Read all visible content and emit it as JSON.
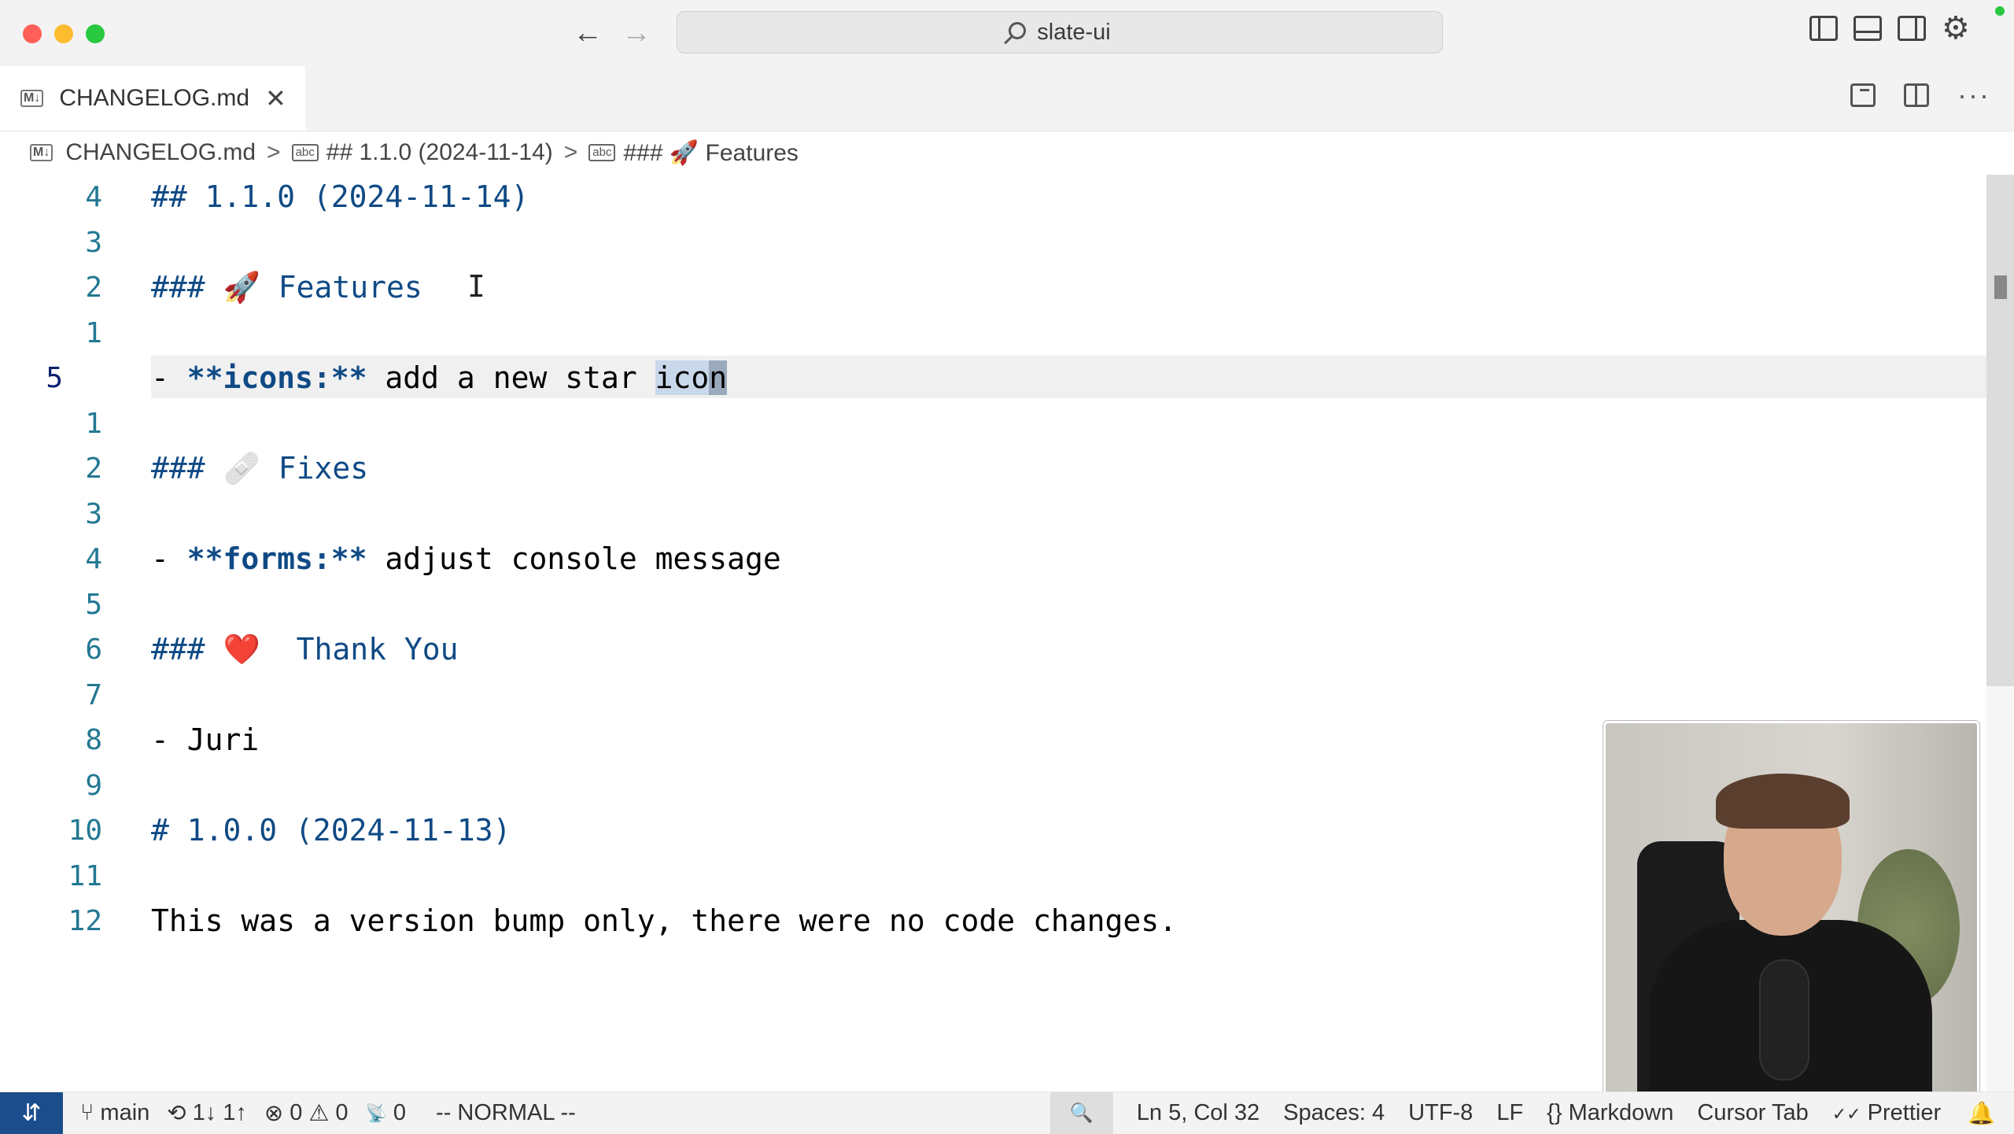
{
  "window": {
    "title": "slate-ui"
  },
  "tabs": [
    {
      "label": "CHANGELOG.md",
      "badge": "M↓"
    }
  ],
  "breadcrumb": [
    {
      "label": "CHANGELOG.md",
      "icon": "M↓"
    },
    {
      "label": "## 1.1.0 (2024-11-14)",
      "icon": "abc"
    },
    {
      "label": "### 🚀 Features",
      "icon": "abc"
    }
  ],
  "editor": {
    "lines": [
      {
        "number": "4",
        "text": "## 1.1.0 (2024-11-14)"
      },
      {
        "number": "3",
        "text": ""
      },
      {
        "number": "2",
        "text": "### 🚀 Features"
      },
      {
        "number": "1",
        "text": ""
      },
      {
        "number": "5",
        "text": "- **icons:** add a new star icon",
        "current": true
      },
      {
        "number": "1",
        "text": ""
      },
      {
        "number": "2",
        "text": "### 🩹 Fixes"
      },
      {
        "number": "3",
        "text": ""
      },
      {
        "number": "4",
        "text": "- **forms:** adjust console message"
      },
      {
        "number": "5",
        "text": ""
      },
      {
        "number": "6",
        "text": "### ❤️  Thank You"
      },
      {
        "number": "7",
        "text": ""
      },
      {
        "number": "8",
        "text": "- Juri"
      },
      {
        "number": "9",
        "text": ""
      },
      {
        "number": "10",
        "text": "# 1.0.0 (2024-11-13)"
      },
      {
        "number": "11",
        "text": ""
      },
      {
        "number": "12",
        "text": "This was a version bump only, there were no code changes."
      }
    ]
  },
  "statusbar": {
    "remote_icon": "⇵",
    "branch": "main",
    "sync": "1↓ 1↑",
    "errors": "0",
    "warnings": "0",
    "ports": "0",
    "mode": "-- NORMAL --",
    "position": "Ln 5, Col 32",
    "spaces": "Spaces: 4",
    "encoding": "UTF-8",
    "eol": "LF",
    "language": "Markdown",
    "cursor_tab": "Cursor Tab",
    "prettier": "Prettier"
  },
  "icons": {
    "nav_back": "←",
    "nav_fwd": "→",
    "close": "✕",
    "gear": "⚙",
    "more": "···",
    "chevron": ">",
    "ibeam": "I",
    "branch": "⑂",
    "sync": "⟲",
    "error": "⊗",
    "warning": "⚠",
    "ports": "📡",
    "zoom": "🔍",
    "braces": "{}",
    "check": "✓✓",
    "bell": "🔔"
  }
}
